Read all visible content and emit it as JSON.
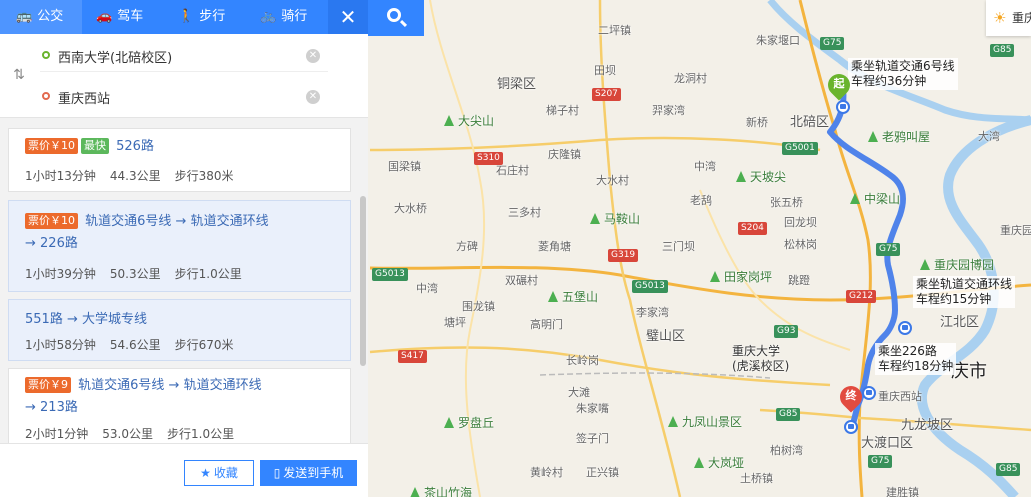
{
  "modes": [
    {
      "label": "公交",
      "icon": "bus-icon"
    },
    {
      "label": "驾车",
      "icon": "car-icon"
    },
    {
      "label": "步行",
      "icon": "walk-icon"
    },
    {
      "label": "骑行",
      "icon": "bike-icon"
    }
  ],
  "route": {
    "origin": "西南大学(北碚校区)",
    "destination": "重庆西站"
  },
  "results": [
    {
      "price": "票价￥10",
      "badge": "最快",
      "name": "526路",
      "time": "1小时13分钟",
      "distance": "44.3公里",
      "walk": "步行380米"
    },
    {
      "price": "票价￥10",
      "badge": "",
      "name": "轨道交通6号线 → 轨道交通环线 → 226路",
      "time": "1小时39分钟",
      "distance": "50.3公里",
      "walk": "步行1.0公里"
    },
    {
      "price": "",
      "badge": "",
      "name": "551路 → 大学城专线",
      "time": "1小时58分钟",
      "distance": "54.6公里",
      "walk": "步行670米"
    },
    {
      "price": "票价￥9",
      "badge": "",
      "name": "轨道交通6号线 → 轨道交通环线 → 213路",
      "time": "2小时1分钟",
      "distance": "53.0公里",
      "walk": "步行1.0公里"
    }
  ],
  "footer": {
    "favorite": "收藏",
    "send": "发送到手机"
  },
  "weather": {
    "text": "重庆"
  },
  "map": {
    "notes": [
      {
        "line1": "乘坐轨道交通6号线",
        "line2": "车程约36分钟"
      },
      {
        "line1": "乘坐轨道交通环线",
        "line2": "车程约15分钟"
      },
      {
        "line1": "乘坐226路",
        "line2": "车程约18分钟"
      }
    ],
    "start_label": "起",
    "end_label": "终",
    "districts": [
      "铜梁区",
      "北碚区",
      "璧山区",
      "九龙坡区",
      "大渡口区",
      "江北区"
    ],
    "city": "庆市",
    "uni": {
      "line1": "重庆大学",
      "line2": "(虎溪校区)"
    },
    "places": [
      "朱家堰口",
      "二坪镇",
      "田坝",
      "龙洞村",
      "梯子村",
      "羿家湾",
      "新桥",
      "国梁镇",
      "石庄村",
      "庆隆镇",
      "大水村",
      "三多村",
      "大水桥",
      "方碑",
      "菱角塘",
      "中湾",
      "老鸹",
      "张五桥",
      "回龙坝",
      "松林岗",
      "三门坝",
      "双碾村",
      "中湾",
      "围龙镇",
      "李家湾",
      "高明门",
      "长岭岗",
      "塘坪",
      "大滩",
      "朱家嘴",
      "签子门",
      "黄岭村",
      "正兴镇",
      "柏树湾",
      "土桥镇",
      "大湾",
      "跳蹬",
      "建胜镇",
      "重庆园",
      "重庆西站"
    ],
    "parks": [
      "大尖山",
      "马鞍山",
      "五堡山",
      "罗盘丘",
      "天坡尖",
      "老鸦叫屋",
      "中梁山",
      "田家岗坪",
      "九凤山景区",
      "大岚垭",
      "重庆园博园",
      "茶山竹海"
    ],
    "shields": [
      "G75",
      "G85",
      "S207",
      "S310",
      "G5001",
      "S204",
      "G319",
      "G5013",
      "G5013",
      "G212",
      "G75",
      "G93",
      "S417",
      "G85",
      "G75",
      "G85"
    ]
  }
}
